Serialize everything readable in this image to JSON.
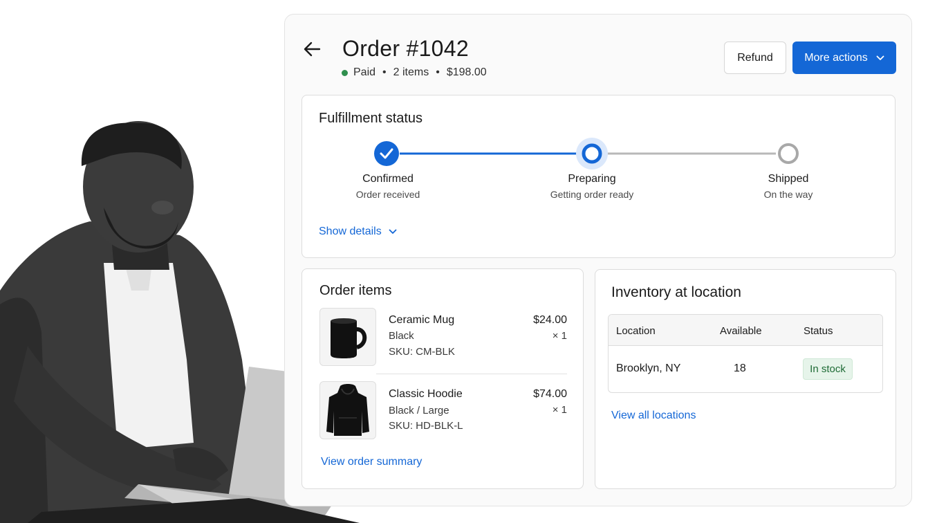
{
  "order": {
    "title": "Order #1042",
    "status": "Paid",
    "items_count": "2 items",
    "total": "$198.00",
    "separator": "•"
  },
  "actions": {
    "refund_label": "Refund",
    "more_label": "More actions"
  },
  "fulfillment": {
    "title": "Fulfillment status",
    "steps": [
      {
        "label": "Confirmed",
        "sub": "Order received",
        "state": "complete"
      },
      {
        "label": "Preparing",
        "sub": "Getting order ready",
        "state": "current"
      },
      {
        "label": "Shipped",
        "sub": "On the way",
        "state": "pending"
      }
    ],
    "show_details": "Show details"
  },
  "order_items": {
    "title": "Order items",
    "items": [
      {
        "name": "Ceramic Mug",
        "variant": "Black",
        "sku": "SKU: CM-BLK",
        "price": "$24.00",
        "qty": "× 1",
        "icon": "mug-icon"
      },
      {
        "name": "Classic Hoodie",
        "variant": "Black / Large",
        "sku": "SKU: HD-BLK-L",
        "price": "$74.00",
        "qty": "× 1",
        "icon": "hoodie-icon"
      }
    ],
    "view_summary": "View order summary"
  },
  "inventory": {
    "title": "Inventory at location",
    "headers": [
      "Location",
      "Available",
      "Status"
    ],
    "rows": [
      {
        "location": "Brooklyn, NY",
        "available": "18",
        "status": "In stock"
      }
    ],
    "view_all": "View all locations"
  },
  "colors": {
    "accent": "#1467d6",
    "paid_dot": "#2f8f4e",
    "in_stock_bg": "#e6f4ea",
    "in_stock_text": "#1e6b35"
  }
}
